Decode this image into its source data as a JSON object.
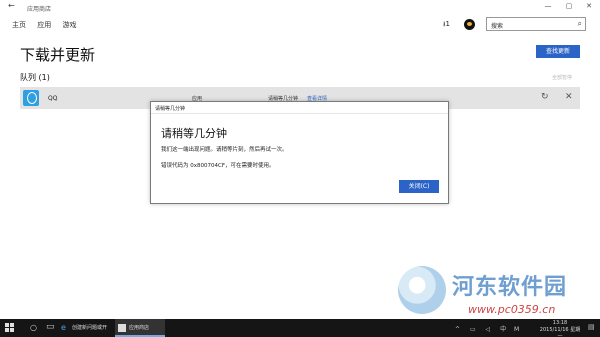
{
  "window": {
    "title": "应用商店",
    "controls": [
      "—",
      "▢",
      "✕"
    ]
  },
  "nav": {
    "items": [
      "主页",
      "应用",
      "游戏"
    ],
    "downloads_count": "1",
    "search_value": "搜索"
  },
  "page": {
    "title": "下载并更新",
    "check_updates_label": "查找更新",
    "queue_label": "队列 (1)",
    "pause_all_label": "全部暂停"
  },
  "queue_items": [
    {
      "name": "QQ",
      "category": "应用",
      "status": "请稍等几分钟",
      "details_link": "查看详情"
    }
  ],
  "dialog": {
    "title": "请稍等几分钟",
    "heading": "请稍等几分钟",
    "message": "我们这一端出现问题。请稍等片刻，然后再试一次。",
    "error_code": "错误代码为 0x800704CF，可在需要时使用。",
    "close_label": "关闭(C)"
  },
  "watermark": {
    "brand": "河东软件园",
    "site": "www.pc0359.cn"
  },
  "taskbar": {
    "tasks": [
      {
        "label": "创建新问题或开始..."
      },
      {
        "label": "应用商店"
      }
    ],
    "tray_lang": "中",
    "time": "13:18",
    "date": "2015/11/16 星期一"
  },
  "colors": {
    "accent": "#2b64c6",
    "qq_icon": "#2e9fe0",
    "taskbar": "#151515"
  }
}
